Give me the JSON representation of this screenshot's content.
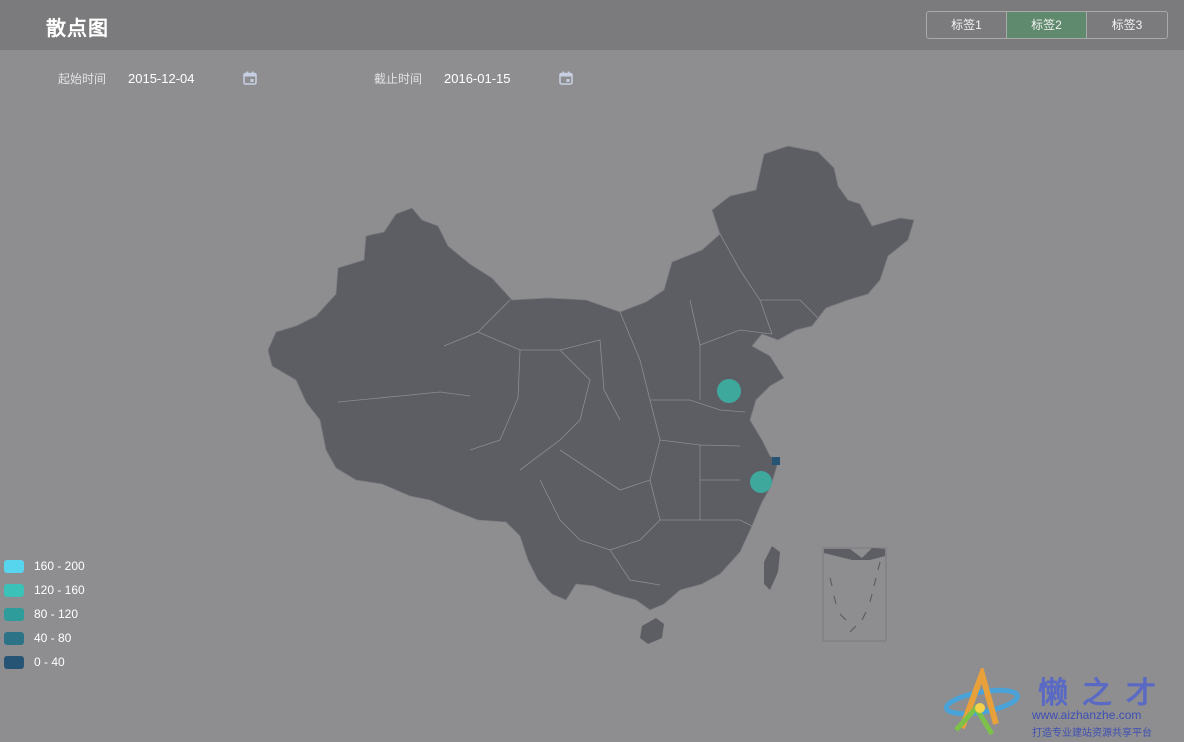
{
  "header": {
    "title": "散点图",
    "tabs": [
      {
        "label": "标签1",
        "active": false
      },
      {
        "label": "标签2",
        "active": true
      },
      {
        "label": "标签3",
        "active": false
      }
    ]
  },
  "filters": {
    "start_label": "起始时间",
    "start_value": "2015-12-04",
    "end_label": "截止时间",
    "end_value": "2016-01-15",
    "icon": "calendar-icon"
  },
  "legend": {
    "items": [
      {
        "label": "160 - 200",
        "color": "#58d5ee"
      },
      {
        "label": "120 - 160",
        "color": "#3cc1b8"
      },
      {
        "label": "80 - 120",
        "color": "#2e9c9b"
      },
      {
        "label": "40 - 80",
        "color": "#2c7388"
      },
      {
        "label": "0 - 40",
        "color": "#255474"
      }
    ]
  },
  "watermark": {
    "name": "懒之才",
    "url": "www.aizhanzhe.com",
    "slogan": "打造专业建站资源共享平台"
  },
  "colors": {
    "background": "#8e8e91",
    "header": "#7b7b7d",
    "map_fill": "#5d5e63",
    "active_tab": "#5f8a6d"
  }
}
